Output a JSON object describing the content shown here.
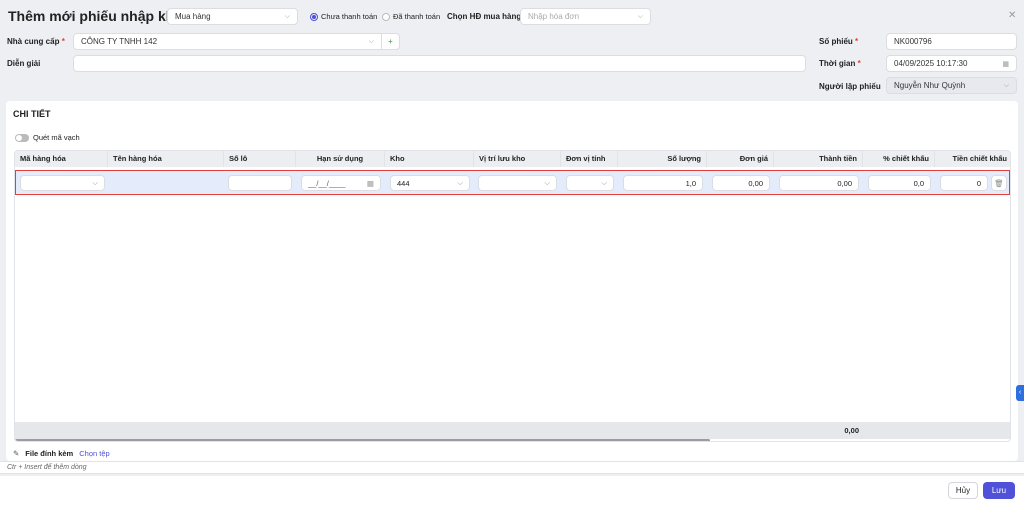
{
  "header": {
    "title": "Thêm mới phiếu nhập kho",
    "type_value": "Mua hàng",
    "payment_options": [
      {
        "label": "Chưa thanh toán",
        "checked": true
      },
      {
        "label": "Đã thanh toán",
        "checked": false
      }
    ],
    "invoice_label": "Chọn HĐ mua hàng",
    "invoice_placeholder": "Nhập hóa đơn"
  },
  "form": {
    "supplier_label": "Nhà cung cấp",
    "supplier_value": "CÔNG TY TNHH 142",
    "add_symbol": "+",
    "description_label": "Diễn giải",
    "description_value": "",
    "voucher_no_label": "Số phiếu",
    "voucher_no_value": "NK000796",
    "time_label": "Thời gian",
    "time_value": "04/09/2025 10:17:30",
    "creator_label": "Người lập phiếu",
    "creator_value": "Nguyễn Như Quỳnh",
    "required_mark": "*"
  },
  "detail": {
    "title": "CHI TIẾT",
    "barcode_label": "Quét mã vạch",
    "columns": [
      "Mã hàng hóa",
      "Tên hàng hóa",
      "Số lô",
      "Hạn sử dụng",
      "Kho",
      "Vị trí lưu kho",
      "Đơn vị tính",
      "Số lượng",
      "Đơn giá",
      "Thành tiền",
      "% chiết khấu",
      "Tiền chiết khấu"
    ],
    "row": {
      "expiry": "__/__/____",
      "warehouse": "444",
      "quantity": "1,0",
      "unit_price": "0,00",
      "amount": "0,00",
      "discount_pct": "0,0",
      "discount_amount": "0"
    },
    "total_amount": "0,00"
  },
  "attachment": {
    "label": "File đính kèm",
    "choose": "Chọn tệp"
  },
  "hint": "Ctr + Insert để thêm dòng",
  "footer": {
    "cancel": "Hủy",
    "save": "Lưu"
  },
  "colors": {
    "primary": "#4f51d8",
    "row_highlight": "#e4ebfb",
    "row_border": "#e0403a"
  }
}
